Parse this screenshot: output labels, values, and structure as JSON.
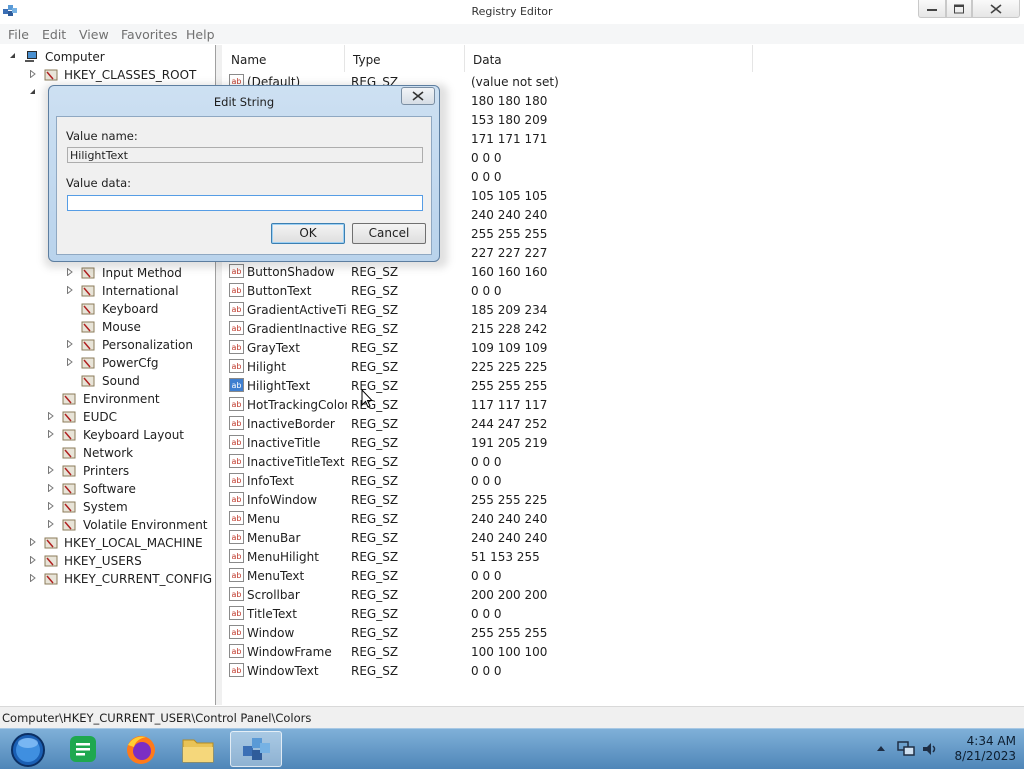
{
  "window": {
    "title": "Registry Editor"
  },
  "menu": [
    "File",
    "Edit",
    "View",
    "Favorites",
    "Help"
  ],
  "tree": {
    "root": "Computer",
    "top_visible": [
      "HKEY_CLASSES_ROOT"
    ],
    "cp_children": [
      "Input Method",
      "International",
      "Keyboard",
      "Mouse",
      "Personalization",
      "PowerCfg",
      "Sound"
    ],
    "hkcu_children": [
      "Environment",
      "EUDC",
      "Keyboard Layout",
      "Network",
      "Printers",
      "Software",
      "System",
      "Volatile Environment"
    ],
    "roots_bottom": [
      "HKEY_LOCAL_MACHINE",
      "HKEY_USERS",
      "HKEY_CURRENT_CONFIG"
    ]
  },
  "list": {
    "columns": [
      "Name",
      "Type",
      "Data"
    ],
    "rows": [
      {
        "name": "(Default)",
        "type": "REG_SZ",
        "data": "(value not set)"
      },
      {
        "name": "",
        "type": "",
        "data": "180 180 180"
      },
      {
        "name": "",
        "type": "",
        "data": "153 180 209"
      },
      {
        "name": "",
        "type": "",
        "data": "171 171 171"
      },
      {
        "name": "",
        "type": "",
        "data": "0 0 0"
      },
      {
        "name": "",
        "type": "",
        "data": "0 0 0"
      },
      {
        "name": "",
        "type": "",
        "data": "105 105 105"
      },
      {
        "name": "",
        "type": "",
        "data": "240 240 240"
      },
      {
        "name": "",
        "type": "",
        "data": "255 255 255"
      },
      {
        "name": "",
        "type": "",
        "data": "227 227 227"
      },
      {
        "name": "ButtonShadow",
        "type": "REG_SZ",
        "data": "160 160 160"
      },
      {
        "name": "ButtonText",
        "type": "REG_SZ",
        "data": "0 0 0"
      },
      {
        "name": "GradientActiveTitle",
        "type": "REG_SZ",
        "data": "185 209 234"
      },
      {
        "name": "GradientInactiveT...",
        "type": "REG_SZ",
        "data": "215 228 242"
      },
      {
        "name": "GrayText",
        "type": "REG_SZ",
        "data": "109 109 109"
      },
      {
        "name": "Hilight",
        "type": "REG_SZ",
        "data": "225 225 225"
      },
      {
        "name": "HilightText",
        "type": "REG_SZ",
        "data": "255 255 255"
      },
      {
        "name": "HotTrackingColor",
        "type": "REG_SZ",
        "data": "117 117 117"
      },
      {
        "name": "InactiveBorder",
        "type": "REG_SZ",
        "data": "244 247 252"
      },
      {
        "name": "InactiveTitle",
        "type": "REG_SZ",
        "data": "191 205 219"
      },
      {
        "name": "InactiveTitleText",
        "type": "REG_SZ",
        "data": "0 0 0"
      },
      {
        "name": "InfoText",
        "type": "REG_SZ",
        "data": "0 0 0"
      },
      {
        "name": "InfoWindow",
        "type": "REG_SZ",
        "data": "255 255 225"
      },
      {
        "name": "Menu",
        "type": "REG_SZ",
        "data": "240 240 240"
      },
      {
        "name": "MenuBar",
        "type": "REG_SZ",
        "data": "240 240 240"
      },
      {
        "name": "MenuHilight",
        "type": "REG_SZ",
        "data": "51 153 255"
      },
      {
        "name": "MenuText",
        "type": "REG_SZ",
        "data": "0 0 0"
      },
      {
        "name": "Scrollbar",
        "type": "REG_SZ",
        "data": "200 200 200"
      },
      {
        "name": "TitleText",
        "type": "REG_SZ",
        "data": "0 0 0"
      },
      {
        "name": "Window",
        "type": "REG_SZ",
        "data": "255 255 255"
      },
      {
        "name": "WindowFrame",
        "type": "REG_SZ",
        "data": "100 100 100"
      },
      {
        "name": "WindowText",
        "type": "REG_SZ",
        "data": "0 0 0"
      }
    ]
  },
  "dialog": {
    "title": "Edit String",
    "value_name_label": "Value name:",
    "value_name": "HilightText",
    "value_data_label": "Value data:",
    "value_data": "",
    "ok_label": "OK",
    "cancel_label": "Cancel"
  },
  "status": {
    "path": "Computer\\HKEY_CURRENT_USER\\Control Panel\\Colors"
  },
  "taskbar": {
    "time": "4:34 AM",
    "date": "8/21/2023"
  },
  "colors": {
    "taskbar": "#5b8fc0",
    "dialog_frame": "#c4dbf0",
    "selected_icon": "#3f7fd0"
  }
}
